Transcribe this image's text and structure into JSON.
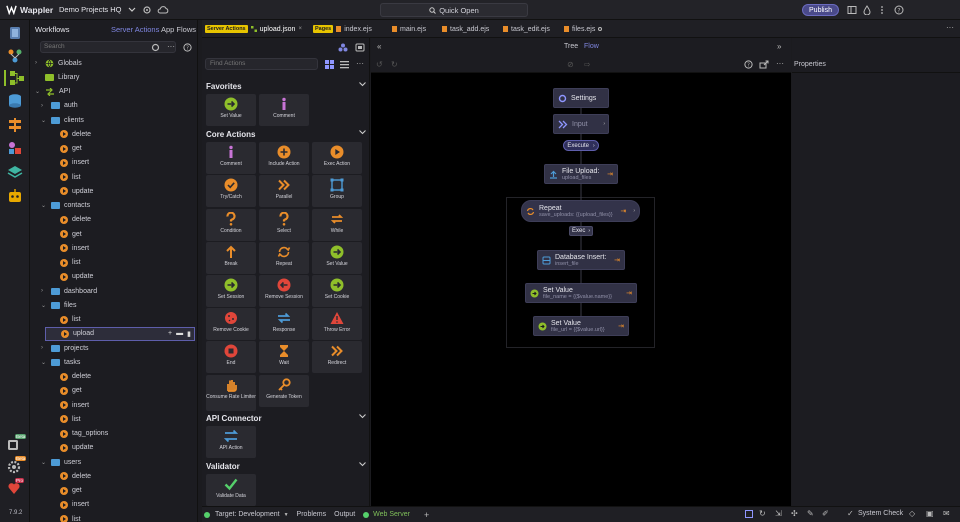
{
  "app": {
    "name": "Wappler",
    "project": "Demo Projects HQ"
  },
  "topbar": {
    "quick_open": "Quick Open",
    "publish": "Publish"
  },
  "rail": {
    "version": "7.9.2",
    "badges": [
      "Beta",
      "Beta",
      "Pro"
    ]
  },
  "workflows": {
    "title": "Workflows",
    "tab_server_actions": "Server Actions",
    "tab_app_flows": "App Flows",
    "search_placeholder": "Search",
    "tree": [
      {
        "label": "Globals",
        "kind": "globe",
        "depth": 0,
        "caret": "closed"
      },
      {
        "label": "Library",
        "kind": "library",
        "depth": 0,
        "caret": "none"
      },
      {
        "label": "API",
        "kind": "api",
        "depth": 0,
        "caret": "open"
      },
      {
        "label": "auth",
        "kind": "folder",
        "depth": 1,
        "caret": "closed"
      },
      {
        "label": "clients",
        "kind": "folder",
        "depth": 1,
        "caret": "open"
      },
      {
        "label": "delete",
        "kind": "file",
        "depth": 2
      },
      {
        "label": "get",
        "kind": "file",
        "depth": 2
      },
      {
        "label": "insert",
        "kind": "file",
        "depth": 2
      },
      {
        "label": "list",
        "kind": "file",
        "depth": 2
      },
      {
        "label": "update",
        "kind": "file",
        "depth": 2
      },
      {
        "label": "contacts",
        "kind": "folder",
        "depth": 1,
        "caret": "open"
      },
      {
        "label": "delete",
        "kind": "file",
        "depth": 2
      },
      {
        "label": "get",
        "kind": "file",
        "depth": 2
      },
      {
        "label": "insert",
        "kind": "file",
        "depth": 2
      },
      {
        "label": "list",
        "kind": "file",
        "depth": 2
      },
      {
        "label": "update",
        "kind": "file",
        "depth": 2
      },
      {
        "label": "dashboard",
        "kind": "folder",
        "depth": 1,
        "caret": "closed"
      },
      {
        "label": "files",
        "kind": "folder",
        "depth": 1,
        "caret": "open"
      },
      {
        "label": "list",
        "kind": "file",
        "depth": 2
      },
      {
        "label": "upload",
        "kind": "file",
        "depth": 2,
        "selected": true
      },
      {
        "label": "projects",
        "kind": "folder",
        "depth": 1,
        "caret": "closed"
      },
      {
        "label": "tasks",
        "kind": "folder",
        "depth": 1,
        "caret": "open"
      },
      {
        "label": "delete",
        "kind": "file",
        "depth": 2
      },
      {
        "label": "get",
        "kind": "file",
        "depth": 2
      },
      {
        "label": "insert",
        "kind": "file",
        "depth": 2
      },
      {
        "label": "list",
        "kind": "file",
        "depth": 2
      },
      {
        "label": "tag_options",
        "kind": "file",
        "depth": 2
      },
      {
        "label": "update",
        "kind": "file",
        "depth": 2
      },
      {
        "label": "users",
        "kind": "folder",
        "depth": 1,
        "caret": "open"
      },
      {
        "label": "delete",
        "kind": "file",
        "depth": 2
      },
      {
        "label": "get",
        "kind": "file",
        "depth": 2
      },
      {
        "label": "insert",
        "kind": "file",
        "depth": 2
      },
      {
        "label": "list",
        "kind": "file",
        "depth": 2
      }
    ]
  },
  "tabs": [
    {
      "label": "upload.json",
      "tag": "Server Actions",
      "active": true,
      "closable": true
    },
    {
      "label": "index.ejs",
      "tag": "Pages"
    },
    {
      "label": "main.ejs"
    },
    {
      "label": "task_add.ejs"
    },
    {
      "label": "task_edit.ejs"
    },
    {
      "label": "files.ejs",
      "modified": true
    }
  ],
  "actions_panel": {
    "find_placeholder": "Find Actions",
    "sections": [
      {
        "title": "Favorites",
        "items": [
          {
            "label": "Set Value",
            "icon": "arrow-right-circle-icon",
            "color": "#8fbf2a"
          },
          {
            "label": "Comment",
            "icon": "info-icon",
            "color": "#c874d6"
          }
        ]
      },
      {
        "title": "Core Actions",
        "items": [
          {
            "label": "Comment",
            "icon": "info-icon",
            "color": "#c874d6"
          },
          {
            "label": "Include Action",
            "icon": "plus-circle-icon",
            "color": "#e98d2a"
          },
          {
            "label": "Exec Action",
            "icon": "play-circle-icon",
            "color": "#e98d2a"
          },
          {
            "label": "Try/Catch",
            "icon": "check-circle-icon",
            "color": "#e98d2a"
          },
          {
            "label": "Parallel",
            "icon": "chevrons-right-icon",
            "color": "#e98d2a"
          },
          {
            "label": "Group",
            "icon": "group-icon",
            "color": "#4d9bd6"
          },
          {
            "label": "Condition",
            "icon": "question-icon",
            "color": "#e98d2a"
          },
          {
            "label": "Select",
            "icon": "question-icon",
            "color": "#e98d2a"
          },
          {
            "label": "While",
            "icon": "loop-icon",
            "color": "#e98d2a"
          },
          {
            "label": "Break",
            "icon": "arrow-up-icon",
            "color": "#e98d2a"
          },
          {
            "label": "Repeat",
            "icon": "repeat-icon",
            "color": "#e98d2a"
          },
          {
            "label": "Set Value",
            "icon": "arrow-right-circle-icon",
            "color": "#8fbf2a"
          },
          {
            "label": "Set Session",
            "icon": "arrow-right-circle-icon",
            "color": "#8fbf2a"
          },
          {
            "label": "Remove Session",
            "icon": "arrow-left-circle-icon",
            "color": "#e0463a"
          },
          {
            "label": "Set Cookie",
            "icon": "arrow-right-circle-icon",
            "color": "#8fbf2a"
          },
          {
            "label": "Remove Cookie",
            "icon": "cookie-icon",
            "color": "#e0463a"
          },
          {
            "label": "Response",
            "icon": "response-icon",
            "color": "#4d9bd6"
          },
          {
            "label": "Throw Error",
            "icon": "warning-icon",
            "color": "#e0463a"
          },
          {
            "label": "End",
            "icon": "stop-icon",
            "color": "#e0463a"
          },
          {
            "label": "Wait",
            "icon": "hourglass-icon",
            "color": "#e98d2a"
          },
          {
            "label": "Redirect",
            "icon": "chevrons-right-icon",
            "color": "#e98d2a"
          },
          {
            "label": "Consume Rate Limiter",
            "icon": "hand-icon",
            "color": "#e98d2a"
          },
          {
            "label": "Generate Token",
            "icon": "key-icon",
            "color": "#e98d2a"
          }
        ]
      },
      {
        "title": "API Connector",
        "items": [
          {
            "label": "API Action",
            "icon": "swap-icon",
            "color": "#4d9bd6"
          }
        ]
      },
      {
        "title": "Validator",
        "items": [
          {
            "label": "Validate Data",
            "icon": "check-icon",
            "color": "#55d06b"
          }
        ]
      }
    ]
  },
  "canvas": {
    "view_tree": "Tree",
    "view_flow": "Flow",
    "nodes": {
      "settings": "Settings",
      "input": "Input",
      "execute": "Execute",
      "file_upload_title": "File Upload:",
      "file_upload_sub": "upload_files",
      "repeat_title": "Repeat",
      "repeat_sub": "save_uploads: {{upload_files}}",
      "exec": "Exec",
      "db_insert_title": "Database Insert:",
      "db_insert_sub": "insert_file",
      "set1_title": "Set Value",
      "set1_sub": "file_name = {{$value.name}}",
      "set2_title": "Set Value",
      "set2_sub": "file_url = {{$value.url}}"
    }
  },
  "properties": {
    "title": "Properties"
  },
  "status": {
    "target_label": "Target: Development",
    "problems": "Problems",
    "output": "Output",
    "web_server": "Web Server",
    "system_check": "System Check"
  }
}
